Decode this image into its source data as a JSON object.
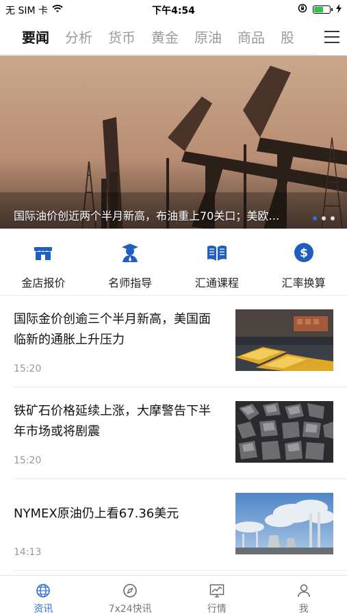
{
  "status_bar": {
    "carrier": "无 SIM 卡",
    "time": "下午4:54"
  },
  "top_tabs": [
    "要闻",
    "分析",
    "货币",
    "黄金",
    "原油",
    "商品",
    "股"
  ],
  "banner": {
    "caption": "国际油价创近两个半月新高，布油重上70关口；美欧…"
  },
  "quick_entries": [
    {
      "label": "金店报价",
      "icon": "store-icon"
    },
    {
      "label": "名师指导",
      "icon": "teacher-icon"
    },
    {
      "label": "汇通课程",
      "icon": "book-icon"
    },
    {
      "label": "汇率换算",
      "icon": "dollar-icon"
    }
  ],
  "news": [
    {
      "title": "国际金价创逾三个半月新高，美国面临新的通胀上升压力",
      "time": "15:20",
      "image": "gold-bars"
    },
    {
      "title": "铁矿石价格延续上涨，大摩警告下半年市场或将剧震",
      "time": "15:20",
      "image": "iron-ore"
    },
    {
      "title": "NYMEX原油仍上看67.36美元",
      "time": "14:13",
      "image": "refinery"
    }
  ],
  "bottom_nav": [
    {
      "label": "资讯",
      "icon": "globe-icon"
    },
    {
      "label": "7x24快讯",
      "icon": "compass-icon"
    },
    {
      "label": "行情",
      "icon": "chart-monitor-icon"
    },
    {
      "label": "我",
      "icon": "user-icon"
    }
  ],
  "colors": {
    "accent": "#2f6fd8",
    "icon_blue": "#1f5fbf"
  }
}
